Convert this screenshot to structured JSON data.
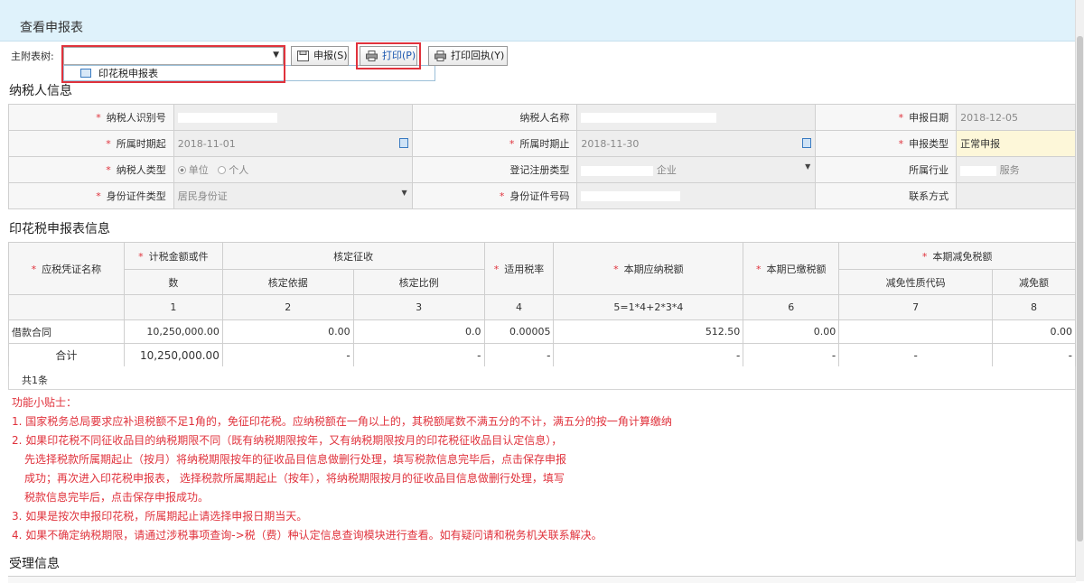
{
  "title": "查看申报表",
  "toolbar": {
    "attach_label": "主附表树:",
    "dropdown_item": "印花税申报表",
    "declare_button": "申报(S)",
    "print_button": "打印(P)",
    "print_receipt_button": "打印回执(Y)"
  },
  "taxpayer_section": {
    "title": "纳税人信息",
    "labels": {
      "taxpayer_id": "纳税人识别号",
      "taxpayer_name": "纳税人名称",
      "declare_date": "申报日期",
      "period_start": "所属时期起",
      "period_end": "所属时期止",
      "declare_type": "申报类型",
      "taxpayer_type": "纳税人类型",
      "registration_type": "登记注册类型",
      "industry": "所属行业",
      "id_type": "身份证件类型",
      "id_number": "身份证件号码",
      "contact": "联系方式"
    },
    "values": {
      "declare_date": "2018-12-05",
      "period_start": "2018-11-01",
      "period_end": "2018-11-30",
      "declare_type": "正常申报",
      "taxpayer_type_opt1": "单位",
      "taxpayer_type_opt2": "个人",
      "registration_type_suffix": "企业",
      "industry_suffix": "服务",
      "id_type": "居民身份证"
    }
  },
  "stamp_section": {
    "title": "印花税申报表信息",
    "headers": {
      "voucher_name": "应税凭证名称",
      "tax_amount": "计税金额或件",
      "tax_amount_2": "数",
      "assessed": "核定征收",
      "assessed_basis": "核定依据",
      "assessed_ratio": "核定比例",
      "rate": "适用税率",
      "payable": "本期应纳税额",
      "paid": "本期已缴税额",
      "relief": "本期减免税额",
      "relief_code": "减免性质代码",
      "relief_amount": "减免额"
    },
    "col_numbers": [
      "1",
      "2",
      "3",
      "4",
      "5=1*4+2*3*4",
      "6",
      "7",
      "8"
    ],
    "rows": [
      {
        "name": "借款合同",
        "amount": "10,250,000.00",
        "basis": "0.00",
        "ratio": "0.0",
        "rate": "0.00005",
        "payable": "512.50",
        "paid": "0.00",
        "code": "",
        "relief": "0.00"
      }
    ],
    "total": {
      "name": "合计",
      "amount": "10,250,000.00",
      "basis": "-",
      "ratio": "-",
      "rate": "-",
      "payable": "-",
      "paid": "-",
      "code": "-",
      "relief": "-"
    },
    "count": "共1条"
  },
  "tips": [
    "功能小贴士：",
    "1. 国家税务总局要求应补退税额不足1角的，免征印花税。应纳税额在一角以上的，其税额尾数不满五分的不计，满五分的按一角计算缴纳",
    "2. 如果印花税不同征收品目的纳税期限不同（既有纳税期限按年，又有纳税期限按月的印花税征收品目认定信息），",
    "   先选择税款所属期起止（按月）将纳税期限按年的征收品目信息做删行处理，填写税款信息完毕后，点击保存申报",
    "   成功；再次进入印花税申报表， 选择税款所属期起止（按年），将纳税期限按月的征收品目信息做删行处理，填写",
    "   税款信息完毕后，点击保存申报成功。",
    "3. 如果是按次申报印花税，所属期起止请选择申报日期当天。",
    "4. 如果不确定纳税期限，请通过涉税事项查询->税（费）种认定信息查询模块进行查看。如有疑问请和税务机关联系解决。"
  ],
  "accept_section": {
    "title": "受理信息"
  }
}
